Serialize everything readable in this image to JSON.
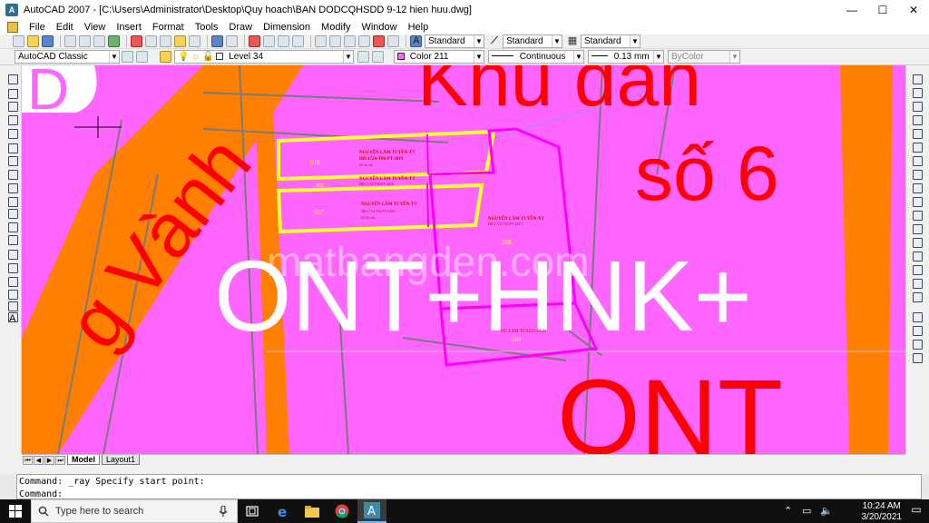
{
  "window": {
    "title": "AutoCAD 2007 - [C:\\Users\\Administrator\\Desktop\\Quy hoach\\BAN DODCQHSDD 9-12 hien huu.dwg]",
    "app_icon": "A",
    "controls": {
      "minimize": "—",
      "maximize": "☐",
      "close": "✕"
    }
  },
  "menu": [
    "File",
    "Edit",
    "View",
    "Insert",
    "Format",
    "Tools",
    "Draw",
    "Dimension",
    "Modify",
    "Window",
    "Help"
  ],
  "toolbar": {
    "text_style": "Standard",
    "dim_style": "Standard",
    "table_style": "Standard",
    "workspace": "AutoCAD Classic",
    "layer": "Level 34",
    "color": "Color 211",
    "linetype": "Continuous",
    "lineweight": "0.13 mm",
    "plotstyle": "ByColor",
    "color_swatch": "#ff66ff"
  },
  "drawing": {
    "big_labels": {
      "khu_dan": "Khu dân",
      "so6": "số 6",
      "ont_hnk": "ONT+HNK+",
      "ont": "ONT",
      "vanh": "g Vành",
      "d": "D"
    },
    "watermark": "matbangden.com",
    "parcels": [
      {
        "id": "519",
        "owner": "NGUYỄN LÂM TUYỀN-TT",
        "meta": "HĐ:1724-T06-PT-2019",
        "extra": "65 lúc.nh"
      },
      {
        "id": "566",
        "owner": "NGUYỄN LÂM TUYỀN-TT",
        "meta": "HĐ:1724-T06-PT-2019"
      },
      {
        "id": "567",
        "owner": "NGUYỄN LÂM TUYỀN-TT",
        "meta": "HĐ:1724-T06-PT-2019",
        "extra": "65 lúc.nh"
      },
      {
        "id": "568",
        "owner": "NGUYỄN LÂM TUYỀN-NT",
        "meta": "HĐ:1724-T05-PT-2019"
      },
      {
        "id": "569",
        "owner": "NG LAM TUYEN-NCN"
      }
    ],
    "colors": {
      "background": "#ff66ff",
      "road": "#ff8000",
      "text": "#ff0000",
      "boundary": "#ffff33",
      "parcel": "#ff00ff"
    }
  },
  "layout_tabs": {
    "nav": [
      "⏮",
      "◀",
      "▶",
      "⏭"
    ],
    "tabs": [
      "Model",
      "Layout1"
    ]
  },
  "command": {
    "line1": "Command: _ray Specify start point:",
    "line2": "Command:"
  },
  "taskbar": {
    "search_placeholder": "Type here to search",
    "time": "10:24 AM",
    "date": "3/20/2021"
  }
}
